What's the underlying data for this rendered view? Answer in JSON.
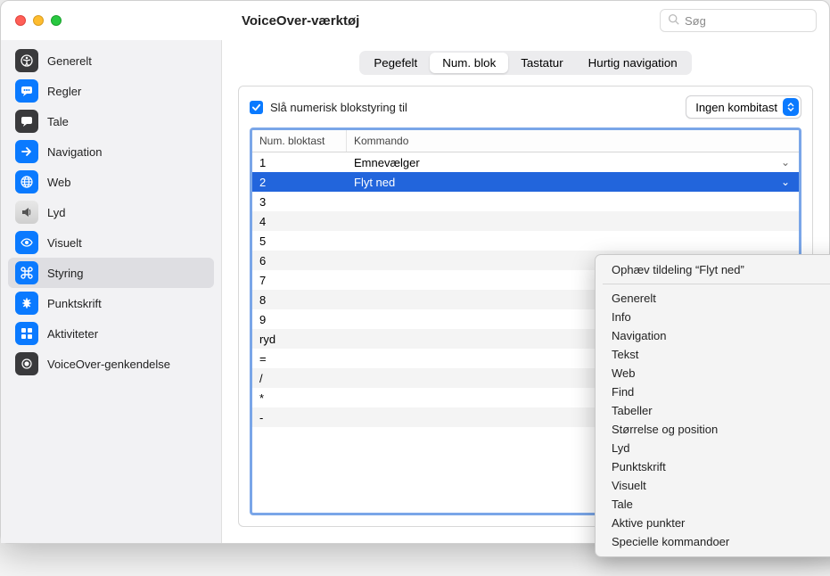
{
  "window": {
    "title": "VoiceOver-værktøj"
  },
  "search": {
    "placeholder": "Søg"
  },
  "sidebar": {
    "items": [
      {
        "label": "Generelt"
      },
      {
        "label": "Regler"
      },
      {
        "label": "Tale"
      },
      {
        "label": "Navigation"
      },
      {
        "label": "Web"
      },
      {
        "label": "Lyd"
      },
      {
        "label": "Visuelt"
      },
      {
        "label": "Styring"
      },
      {
        "label": "Punktskrift"
      },
      {
        "label": "Aktiviteter"
      },
      {
        "label": "VoiceOver-genkendelse"
      }
    ]
  },
  "tabs": {
    "items": [
      {
        "label": "Pegefelt"
      },
      {
        "label": "Num. blok"
      },
      {
        "label": "Tastatur"
      },
      {
        "label": "Hurtig navigation"
      }
    ]
  },
  "panel": {
    "checkbox_label": "Slå numerisk blokstyring til",
    "combo_label": "Ingen kombitast",
    "columns": {
      "key": "Num. bloktast",
      "command": "Kommando"
    },
    "rows": [
      {
        "key": "1",
        "command": "Emnevælger"
      },
      {
        "key": "2",
        "command": "Flyt ned"
      },
      {
        "key": "3",
        "command": ""
      },
      {
        "key": "4",
        "command": ""
      },
      {
        "key": "5",
        "command": ""
      },
      {
        "key": "6",
        "command": ""
      },
      {
        "key": "7",
        "command": ""
      },
      {
        "key": "8",
        "command": ""
      },
      {
        "key": "9",
        "command": ""
      },
      {
        "key": "ryd",
        "command": ""
      },
      {
        "key": "=",
        "command": ""
      },
      {
        "key": "/",
        "command": ""
      },
      {
        "key": "*",
        "command": ""
      },
      {
        "key": "-",
        "command": ""
      }
    ]
  },
  "popup": {
    "unassign": "Ophæv tildeling “Flyt ned”",
    "groups": [
      "Generelt",
      "Info",
      "Navigation",
      "Tekst",
      "Web",
      "Find",
      "Tabeller",
      "Størrelse og position",
      "Lyd",
      "Punktskrift",
      "Visuelt",
      "Tale",
      "Aktive punkter",
      "Specielle kommandoer"
    ]
  }
}
